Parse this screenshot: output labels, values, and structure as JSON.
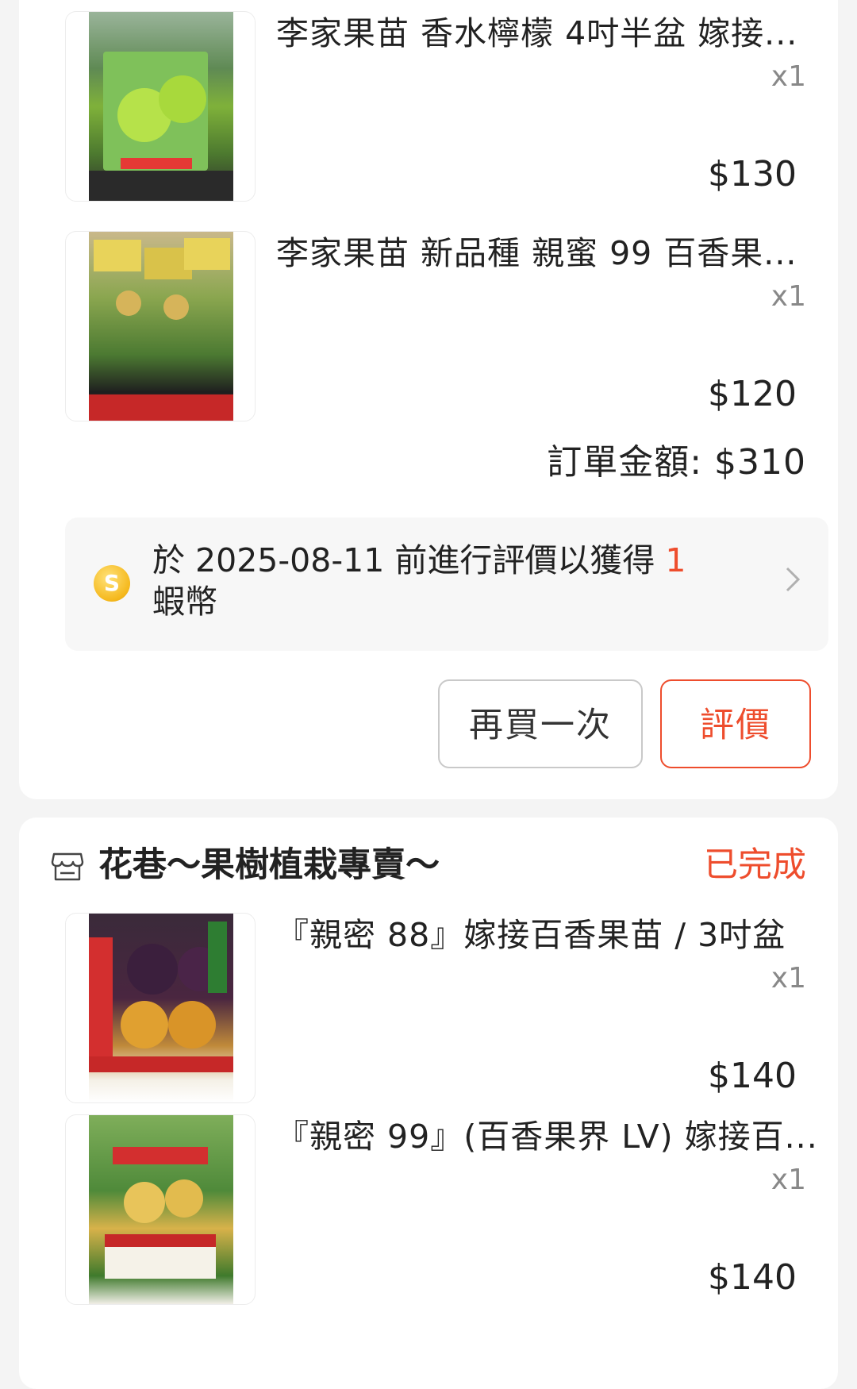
{
  "order1": {
    "items": [
      {
        "title": "李家果苗 香水檸檬 4吋半盆 嫁接...",
        "qty": "x1",
        "price": "$130"
      },
      {
        "title": "李家果苗 新品種 親蜜 99 百香果...",
        "qty": "x1",
        "price": "$120"
      }
    ],
    "total_label": "訂單金額: $310",
    "reward": {
      "text_before": "於 2025-08-11 前進行評價以獲得 ",
      "coin_amount": "1",
      "text_after": " 蝦幣",
      "coin_symbol": "S"
    },
    "buttons": {
      "rebuy": "再買一次",
      "review": "評價"
    }
  },
  "order2": {
    "shop_name": "花巷～果樹植栽專賣～",
    "status": "已完成",
    "items": [
      {
        "title": "『親密 88』嫁接百香果苗 / 3吋盆",
        "qty": "x1",
        "price": "$140"
      },
      {
        "title": "『親密 99』(百香果界 LV) 嫁接百...",
        "qty": "x1",
        "price": "$140"
      }
    ]
  },
  "colors": {
    "accent": "#ee4d2d",
    "coin": "#f5b81c"
  },
  "icons": {
    "store": "store-icon",
    "chevron": "chevron-right-icon",
    "coin": "shopee-coin-icon"
  }
}
